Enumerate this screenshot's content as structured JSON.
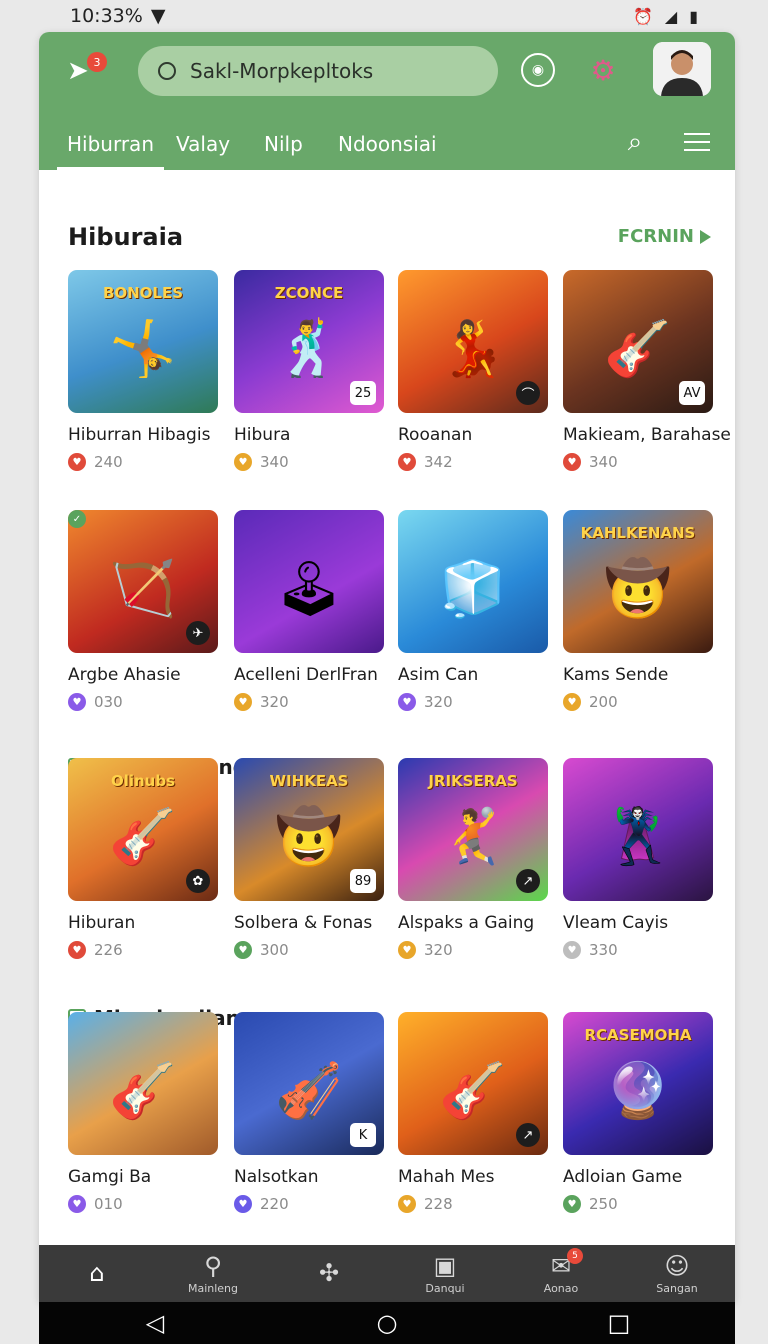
{
  "status_bar": {
    "time": "10:33%"
  },
  "header": {
    "notification_count": "3",
    "search": {
      "value": "Sakl-Morpkepltoks",
      "placeholder": ""
    },
    "tabs": [
      {
        "label": "Hiburran"
      },
      {
        "label": "Valay"
      },
      {
        "label": "Nilp"
      },
      {
        "label": "Ndoonsiai"
      }
    ]
  },
  "section1": {
    "title": "Hiburaia",
    "see_more": "FCRNIN",
    "items": [
      {
        "name": "Hiburran Hibagis",
        "count": "240",
        "thumb_title": "BONOLES",
        "corner": "",
        "icon_color": "#e04a3a",
        "bg": "linear-gradient(160deg,#7ec8e8,#3f8fcb 55%,#2f7a55)"
      },
      {
        "name": "Hibura",
        "count": "340",
        "thumb_title": "ZCONCE",
        "corner": "25",
        "icon_color": "#e8a62a",
        "bg": "linear-gradient(150deg,#3a2aa0,#8b3bd1 50%,#e05ad0)"
      },
      {
        "name": "Rooanan",
        "count": "342",
        "thumb_title": "",
        "corner": "⌒",
        "icon_color": "#e04a3a",
        "bg": "linear-gradient(150deg,#ff9a2e,#d8471c 55%,#5b2a1c)"
      },
      {
        "name": "Makieam, Barahase",
        "count": "340",
        "thumb_title": "",
        "corner": "AV",
        "icon_color": "#e04a3a",
        "bg": "linear-gradient(150deg,#c96a2a,#6b3420 55%,#2a1a14)"
      },
      {
        "name": "Argbe Ahasie",
        "count": "030",
        "thumb_title": "",
        "corner": "✈",
        "icon_color": "#8a5ae8",
        "bg": "linear-gradient(150deg,#f0882e,#c02a20 60%,#5a1a1a)"
      },
      {
        "name": "Acelleni DerlFran",
        "count": "320",
        "thumb_title": "",
        "corner": "",
        "icon_color": "#e8a62a",
        "bg": "linear-gradient(150deg,#5a2ab8,#9a3ad8 60%,#4a1a8a)"
      },
      {
        "name": "Asim Can",
        "count": "320",
        "thumb_title": "",
        "corner": "",
        "icon_color": "#8a5ae8",
        "bg": "linear-gradient(150deg,#7ad8f0,#2a8ad8 60%,#1a5aa8)"
      },
      {
        "name": "Kams Sende",
        "count": "200",
        "thumb_title": "KAHLKENANS",
        "corner": "",
        "icon_color": "#e8a62a",
        "bg": "linear-gradient(150deg,#3a8ad8,#c06a2a 55%,#3a1a10)"
      }
    ]
  },
  "section2": {
    "title": "Marcbepllane",
    "items": [
      {
        "name": "Hiburan",
        "count": "226",
        "thumb_title": "Olinubs",
        "corner": "✿",
        "icon_color": "#e04a3a",
        "bg": "linear-gradient(150deg,#f0c04a,#e0702a 55%,#6a2a14)"
      },
      {
        "name": "Solbera & Fonas",
        "count": "300",
        "thumb_title": "WIHKEAS",
        "corner": "89",
        "icon_color": "#5aa35d",
        "bg": "linear-gradient(150deg,#2a4ab0,#d88a2a 60%,#3a2010)"
      },
      {
        "name": "Alspaks a Gaing",
        "count": "320",
        "thumb_title": "JRIKSERAS",
        "corner": "↗",
        "icon_color": "#e8a62a",
        "bg": "linear-gradient(150deg,#2a3ab0,#d84ab0 50%,#5ad84a)"
      },
      {
        "name": "Vleam Cayis",
        "count": "330",
        "thumb_title": "",
        "corner": "",
        "icon_color": "#bdbdbd",
        "bg": "linear-gradient(150deg,#d84ad0,#6a2ab0 55%,#2a1440)"
      }
    ]
  },
  "section3": {
    "title": "Miorcbepllane",
    "items": [
      {
        "name": "Gamgi Ba",
        "count": "010",
        "thumb_title": "",
        "corner": "",
        "icon_color": "#8a5ae8",
        "bg": "linear-gradient(150deg,#5ab0e8,#e8a04a 55%,#a05a2a)"
      },
      {
        "name": "Nalsotkan",
        "count": "220",
        "thumb_title": "",
        "corner": "K",
        "icon_color": "#6a5ae8",
        "bg": "linear-gradient(150deg,#2a4ab0,#4a6ad0 50%,#1a2a5a)"
      },
      {
        "name": "Mahah Mes",
        "count": "228",
        "thumb_title": "",
        "corner": "↗",
        "icon_color": "#e8a62a",
        "bg": "linear-gradient(150deg,#ffb02a,#e0601a 55%,#6a2a10)"
      },
      {
        "name": "Adloian Game",
        "count": "250",
        "thumb_title": "RCASEMOHA",
        "corner": "",
        "icon_color": "#5aa35d",
        "bg": "linear-gradient(150deg,#d84ad0,#3a2ab0 55%,#1a1040)"
      }
    ]
  },
  "bottom_nav": [
    {
      "label": "",
      "icon": "home-icon"
    },
    {
      "label": "Mainleng",
      "icon": "search-icon"
    },
    {
      "label": "",
      "icon": "gamepad-icon"
    },
    {
      "label": "Danqui",
      "icon": "bag-icon"
    },
    {
      "label": "Aonao",
      "icon": "chat-icon",
      "badge": "5"
    },
    {
      "label": "Sangan",
      "icon": "smile-icon"
    }
  ]
}
